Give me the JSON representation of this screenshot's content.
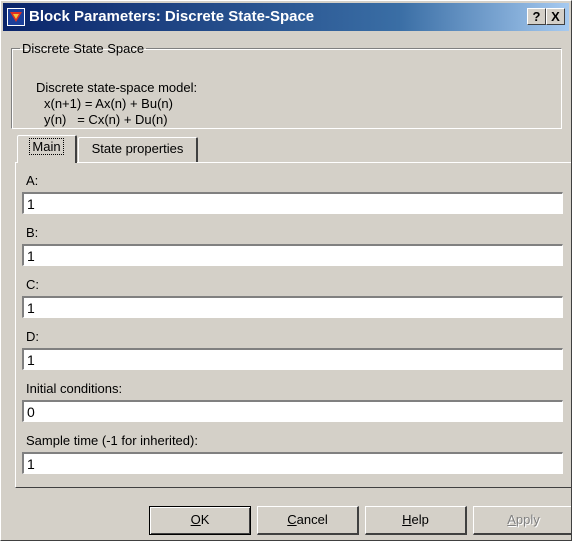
{
  "window": {
    "title": "Block Parameters: Discrete State-Space",
    "help_button": "?",
    "close_button": "X"
  },
  "description": {
    "group_label": "Discrete State Space",
    "title": "Discrete state-space model:",
    "equation_1": "x(n+1) = Ax(n) + Bu(n)",
    "equation_2": "y(n)   = Cx(n) + Du(n)"
  },
  "tabs": [
    {
      "label": "Main",
      "selected": true
    },
    {
      "label": "State properties",
      "selected": false
    }
  ],
  "params": {
    "a": {
      "label": "A:",
      "value": "1"
    },
    "b": {
      "label": "B:",
      "value": "1"
    },
    "c": {
      "label": "C:",
      "value": "1"
    },
    "d": {
      "label": "D:",
      "value": "1"
    },
    "initial_conditions": {
      "label": "Initial conditions:",
      "value": "0"
    },
    "sample_time": {
      "label": "Sample time (-1 for inherited):",
      "value": "1"
    }
  },
  "buttons": {
    "ok": {
      "first": "O",
      "rest": "K"
    },
    "cancel": {
      "first": "C",
      "rest": "ancel"
    },
    "help": {
      "first": "H",
      "rest": "elp"
    },
    "apply": {
      "first": "A",
      "rest": "pply"
    }
  },
  "colors": {
    "dialog_face": "#d4d0c8",
    "title_gradient_start": "#0a246a",
    "title_gradient_end": "#a6caf0",
    "disabled_text": "#808080"
  },
  "icons": {
    "app": "simulink-app-icon"
  }
}
